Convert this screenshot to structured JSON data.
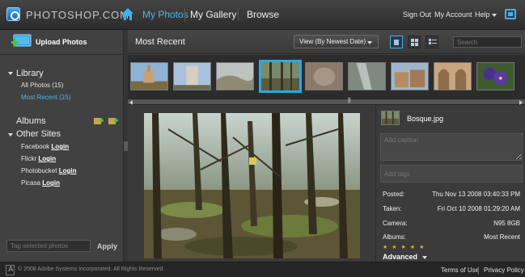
{
  "header": {
    "logo_text": "PHOTOSHOP.COM",
    "nav": [
      "My Photos",
      "My Gallery",
      "Browse"
    ],
    "active_nav": "My Photos",
    "links": {
      "sign_out": "Sign Out",
      "my_account": "My Account",
      "help": "Help"
    }
  },
  "sidebar": {
    "upload_label": "Upload Photos",
    "library": {
      "heading": "Library",
      "items": [
        {
          "label": "All Photos (15)",
          "active": false
        },
        {
          "label": "Most Recent (15)",
          "active": true
        }
      ]
    },
    "albums_heading": "Albums",
    "other_sites": {
      "heading": "Other Sites",
      "sites": [
        {
          "name": "Facebook",
          "action": "Login"
        },
        {
          "name": "Flickr",
          "action": "Login"
        },
        {
          "name": "Photobucket",
          "action": "Login"
        },
        {
          "name": "Picasa",
          "action": "Login"
        }
      ]
    },
    "tag_placeholder": "Tag selected photos",
    "apply_label": "Apply"
  },
  "main": {
    "title": "Most Recent",
    "view_select": "View (By Newest Date)",
    "search_placeholder": "Search",
    "view_modes": [
      "single",
      "grid",
      "list"
    ],
    "active_view_mode": "single"
  },
  "filmstrip": {
    "selected_index": 3,
    "thumbs": [
      {
        "name": "church-photo"
      },
      {
        "name": "tower-building-photo"
      },
      {
        "name": "rocky-landscape-photo"
      },
      {
        "name": "forest-photo"
      },
      {
        "name": "blurry-indoor-photo"
      },
      {
        "name": "stream-photo"
      },
      {
        "name": "village-photo"
      },
      {
        "name": "gothic-arches-photo"
      },
      {
        "name": "purple-pansy-photo"
      }
    ]
  },
  "info": {
    "filename": "Bosque.jpg",
    "caption_placeholder": "Add caption",
    "tags_placeholder": "Add tags",
    "meta": [
      {
        "label": "Posted:",
        "value": "Thu Nov 13 2008 03:40:33 PM"
      },
      {
        "label": "Taken:",
        "value": "Fri Oct 10 2008 01:29:20 AM"
      },
      {
        "label": "Camera:",
        "value": "N95 8GB"
      },
      {
        "label": "Albums:",
        "value": "Most Recent"
      }
    ],
    "rating_stars": "★★★★★",
    "rating": 0,
    "advanced_label": "Advanced"
  },
  "footer": {
    "copyright": "© 2008 Adobe Systems Incorporated. All Rights Reserved.",
    "terms": "Terms of Use",
    "privacy": "Privacy Policy"
  },
  "colors": {
    "accent": "#4fb3ec",
    "selection": "#2aa8ee",
    "star": "#e1b21c",
    "background": "#3a3a3a"
  }
}
